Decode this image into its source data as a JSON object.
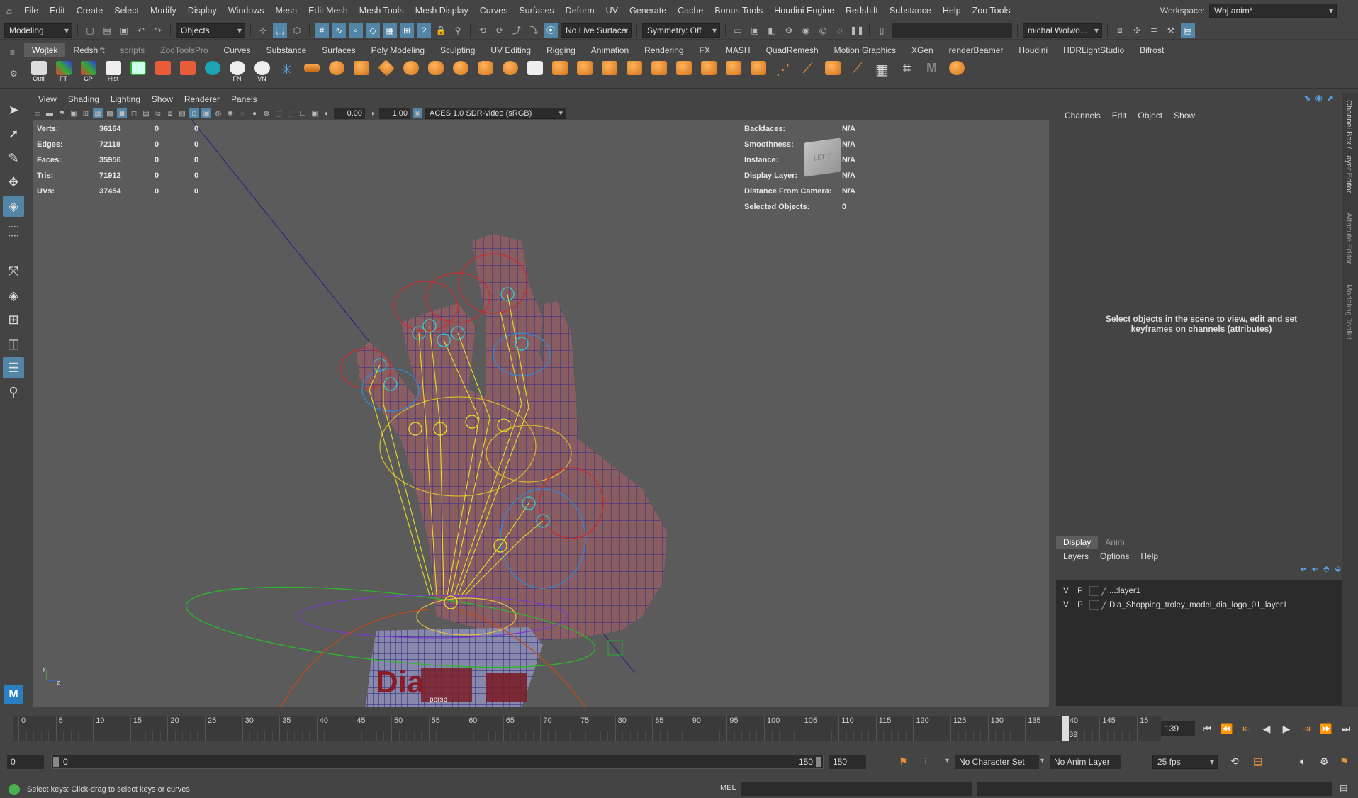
{
  "menubar": {
    "items": [
      "File",
      "Edit",
      "Create",
      "Select",
      "Modify",
      "Display",
      "Windows",
      "Mesh",
      "Edit Mesh",
      "Mesh Tools",
      "Mesh Display",
      "Curves",
      "Surfaces",
      "Deform",
      "UV",
      "Generate",
      "Cache",
      "Bonus Tools",
      "Houdini Engine",
      "Redshift",
      "Substance",
      "Help",
      "Zoo Tools"
    ],
    "workspace_label": "Workspace:",
    "workspace_value": "Woj anim*"
  },
  "toolbar": {
    "mode": "Modeling",
    "select_mode": "Objects",
    "live_surface": "No Live Surface",
    "symmetry": "Symmetry: Off",
    "user": "michał Wolwo..."
  },
  "shelf": {
    "tabs": [
      "Wojtek",
      "Redshift",
      "scripts",
      "ZooToolsPro",
      "Curves",
      "Substance",
      "Surfaces",
      "Poly Modeling",
      "Sculpting",
      "UV Editing",
      "Rigging",
      "Animation",
      "Rendering",
      "FX",
      "MASH",
      "QuadRemesh",
      "Motion Graphics",
      "XGen",
      "renderBeamer",
      "Houdini",
      "HDRLightStudio",
      "Bifrost"
    ],
    "active_tab": "Wojtek",
    "icons": [
      {
        "label": "Outl",
        "icon": "outliner-icon"
      },
      {
        "label": "FT",
        "icon": "freeze-transform-icon"
      },
      {
        "label": "CP",
        "icon": "center-pivot-icon"
      },
      {
        "label": "Hist",
        "icon": "history-icon"
      },
      {
        "label": "FN",
        "icon": "fn-icon"
      },
      {
        "label": "VN",
        "icon": "vn-icon"
      }
    ]
  },
  "viewport": {
    "menu": [
      "View",
      "Shading",
      "Lighting",
      "Show",
      "Renderer",
      "Panels"
    ],
    "exposure": "0.00",
    "gamma": "1.00",
    "color_space": "ACES 1.0 SDR-video (sRGB)",
    "camera_label": "persp",
    "viewcube_label": "LEFT",
    "hud_left": [
      {
        "label": "Verts:",
        "v1": "36164",
        "v2": "0",
        "v3": "0"
      },
      {
        "label": "Edges:",
        "v1": "72118",
        "v2": "0",
        "v3": "0"
      },
      {
        "label": "Faces:",
        "v1": "35956",
        "v2": "0",
        "v3": "0"
      },
      {
        "label": "Tris:",
        "v1": "71912",
        "v2": "0",
        "v3": "0"
      },
      {
        "label": "UVs:",
        "v1": "37454",
        "v2": "0",
        "v3": "0"
      }
    ],
    "hud_right": [
      {
        "label": "Backfaces:",
        "value": "N/A"
      },
      {
        "label": "Smoothness:",
        "value": "N/A"
      },
      {
        "label": "Instance:",
        "value": "N/A"
      },
      {
        "label": "Display Layer:",
        "value": "N/A"
      },
      {
        "label": "Distance From Camera:",
        "value": "N/A"
      },
      {
        "label": "Selected Objects:",
        "value": "0"
      }
    ],
    "sleeve_text": "Dia",
    "axis_y": "y",
    "axis_z": "z"
  },
  "channel_box": {
    "menu": [
      "Channels",
      "Edit",
      "Object",
      "Show"
    ],
    "hint": "Select objects in the scene to view, edit and set keyframes on channels (attributes)"
  },
  "side_tabs": [
    "Channel Box / Layer Editor",
    "Attribute Editor",
    "Modeling Toolkit"
  ],
  "layer_editor": {
    "tabs": [
      "Display",
      "Anim"
    ],
    "menu": [
      "Layers",
      "Options",
      "Help"
    ],
    "layers": [
      {
        "v": "V",
        "p": "P",
        "name": "...:layer1"
      },
      {
        "v": "V",
        "p": "P",
        "name": "Dia_Shopping_troley_model_dia_logo_01_layer1"
      }
    ]
  },
  "timeline": {
    "ticks": [
      "0",
      "5",
      "10",
      "15",
      "20",
      "25",
      "30",
      "35",
      "40",
      "45",
      "50",
      "55",
      "60",
      "65",
      "70",
      "75",
      "80",
      "85",
      "90",
      "95",
      "100",
      "105",
      "110",
      "115",
      "120",
      "125",
      "130",
      "135",
      "140",
      "145",
      "15"
    ],
    "current_frame_marker": "139",
    "current_frame": "139"
  },
  "range": {
    "start": "0",
    "range_start": "0",
    "range_end": "150",
    "end": "150",
    "character_set": "No Character Set",
    "anim_layer": "No Anim Layer",
    "fps": "25 fps"
  },
  "status": {
    "help_line": "Select keys: Click-drag to select keys or curves",
    "cmd_label": "MEL"
  }
}
